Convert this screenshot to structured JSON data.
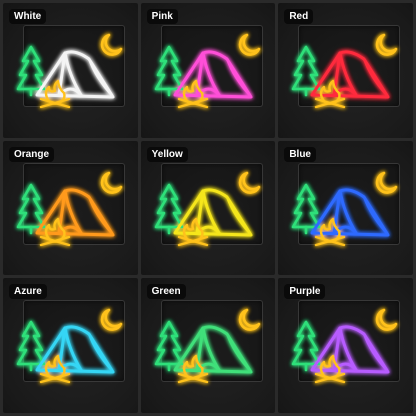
{
  "variants": [
    {
      "label": "White",
      "color": "#f4f4f4"
    },
    {
      "label": "Pink",
      "color": "#ff4fd8"
    },
    {
      "label": "Red",
      "color": "#ff2a3c"
    },
    {
      "label": "Orange",
      "color": "#ff9a1e"
    },
    {
      "label": "Yellow",
      "color": "#f5e61a"
    },
    {
      "label": "Blue",
      "color": "#2e6bff"
    },
    {
      "label": "Azure",
      "color": "#36d6f5"
    },
    {
      "label": "Green",
      "color": "#3fe07a"
    },
    {
      "label": "Purple",
      "color": "#b75bff"
    }
  ],
  "fixed_colors": {
    "tree": "#2fe07a",
    "moon": "#ffc21a",
    "fire": "#ffc21a"
  },
  "icons": [
    "tree-icon",
    "tent-icon",
    "moon-icon",
    "campfire-icon"
  ]
}
